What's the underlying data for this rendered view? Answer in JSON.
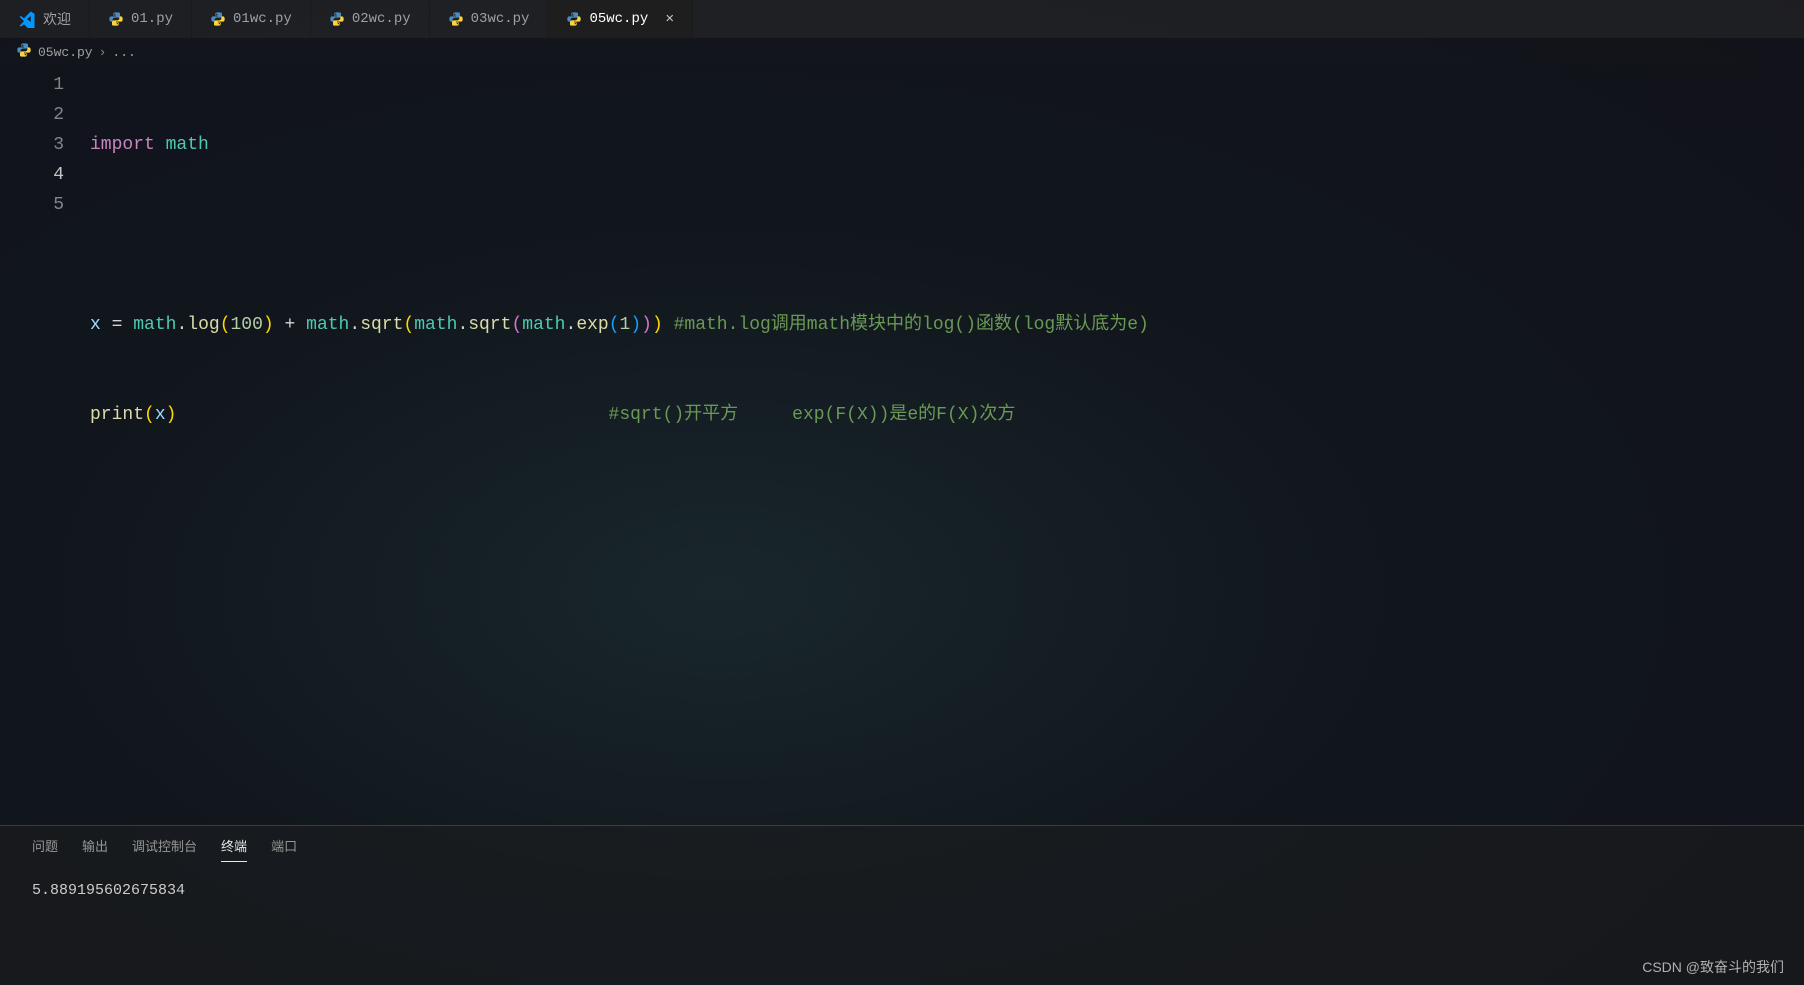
{
  "tabs": [
    {
      "label": "欢迎",
      "type": "vscode"
    },
    {
      "label": "01.py",
      "type": "py"
    },
    {
      "label": "01wc.py",
      "type": "py"
    },
    {
      "label": "02wc.py",
      "type": "py"
    },
    {
      "label": "03wc.py",
      "type": "py"
    },
    {
      "label": "05wc.py",
      "type": "py",
      "active": true
    }
  ],
  "breadcrumb": {
    "file": "05wc.py",
    "rest": "..."
  },
  "editor": {
    "line_numbers": [
      "1",
      "2",
      "3",
      "4",
      "5"
    ],
    "current_line": 4,
    "lines": {
      "l1": {
        "import": "import",
        "sp": " ",
        "math": "math"
      },
      "l3": {
        "x": "x",
        "sp": " ",
        "eq": "=",
        "math1": "math",
        "dot": ".",
        "log": "log",
        "lp": "(",
        "n100": "100",
        "rp": ")",
        "plus": "+",
        "sqrt": "sqrt",
        "exp": "exp",
        "n1": "1",
        "comment": "#math.log调用math模块中的log()函数(log默认底为e)"
      },
      "l4": {
        "print": "print",
        "lp": "(",
        "x": "x",
        "rp": ")",
        "pad": "                                        ",
        "comment": "#sqrt()开平方     exp(F(X))是e的F(X)次方"
      }
    }
  },
  "panel": {
    "tabs": {
      "problems": "问题",
      "output": "输出",
      "debug": "调试控制台",
      "terminal": "终端",
      "ports": "端口"
    },
    "active_tab": "terminal",
    "terminal_output": "5.889195602675834"
  },
  "watermark": "CSDN @致奋斗的我们"
}
